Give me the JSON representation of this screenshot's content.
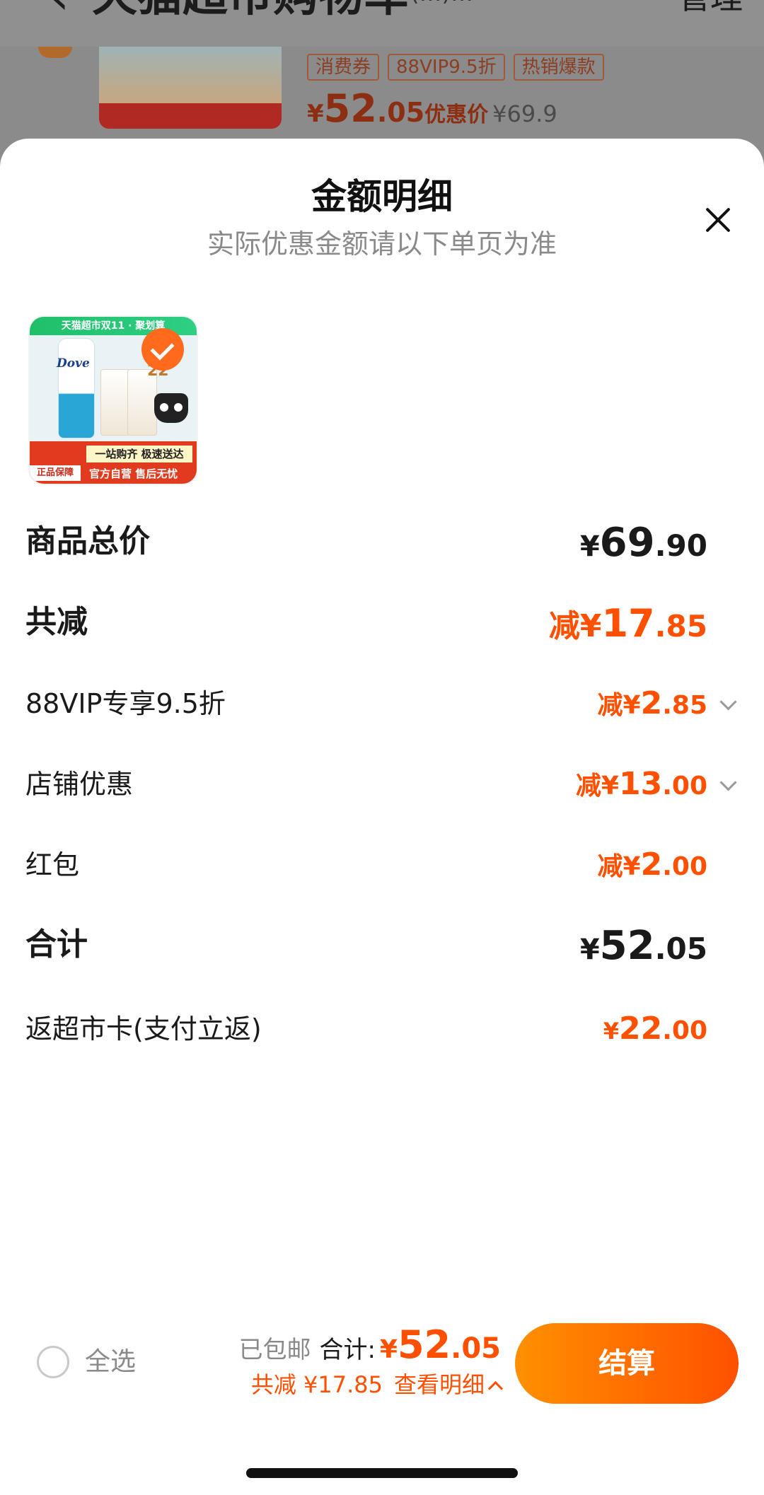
{
  "background": {
    "header_title": "天猫超市购物车",
    "header_title_extra": "(…)…",
    "manage_label": "管理",
    "product": {
      "tags": [
        "消费券",
        "88VIP9.5折",
        "热销爆款"
      ],
      "price_yen": "¥",
      "price_int": "52",
      "price_dec": ".05",
      "price_label": "优惠价",
      "original_price": "¥69.9"
    }
  },
  "sheet": {
    "title": "金额明细",
    "subtitle": "实际优惠金额请以下单页为准",
    "product_thumb": {
      "banner_text": "天猫超市双11 · 聚划算",
      "brand": "Dove",
      "promo_number": "22",
      "red_strip_top": "一站购齐 极速送达",
      "red_strip_bottom": "官方自营 售后无忧",
      "guarantee": "正品保障"
    },
    "rows": [
      {
        "label": "商品总价",
        "prefix": "¥",
        "int": "69",
        "dec": ".90"
      },
      {
        "label": "共减",
        "prefix": "减¥",
        "int": "17",
        "dec": ".85"
      },
      {
        "label": "88VIP专享9.5折",
        "prefix": "减¥",
        "int": "2",
        "dec": ".85"
      },
      {
        "label": "店铺优惠",
        "prefix": "减¥",
        "int": "13",
        "dec": ".00"
      },
      {
        "label": "红包",
        "prefix": "减¥",
        "int": "2",
        "dec": ".00"
      },
      {
        "label": "合计",
        "prefix": "¥",
        "int": "52",
        "dec": ".05"
      },
      {
        "label": "返超市卡(支付立返)",
        "prefix": "¥",
        "int": "22",
        "dec": ".00"
      }
    ]
  },
  "checkout_bar": {
    "select_all_label": "全选",
    "free_shipping": "已包邮",
    "total_label": "合计:",
    "total_yen": "¥",
    "total_int": "52",
    "total_dec": ".05",
    "discount_text": "共减 ¥17.85",
    "detail_link": "查看明细",
    "checkout_label": "结算"
  },
  "colors": {
    "accent": "#ff5000",
    "accent_gradient_start": "#ff9000",
    "text_primary": "#1a1a1a",
    "text_secondary": "#8a8a8a",
    "overlay": "#8b8b8b"
  }
}
